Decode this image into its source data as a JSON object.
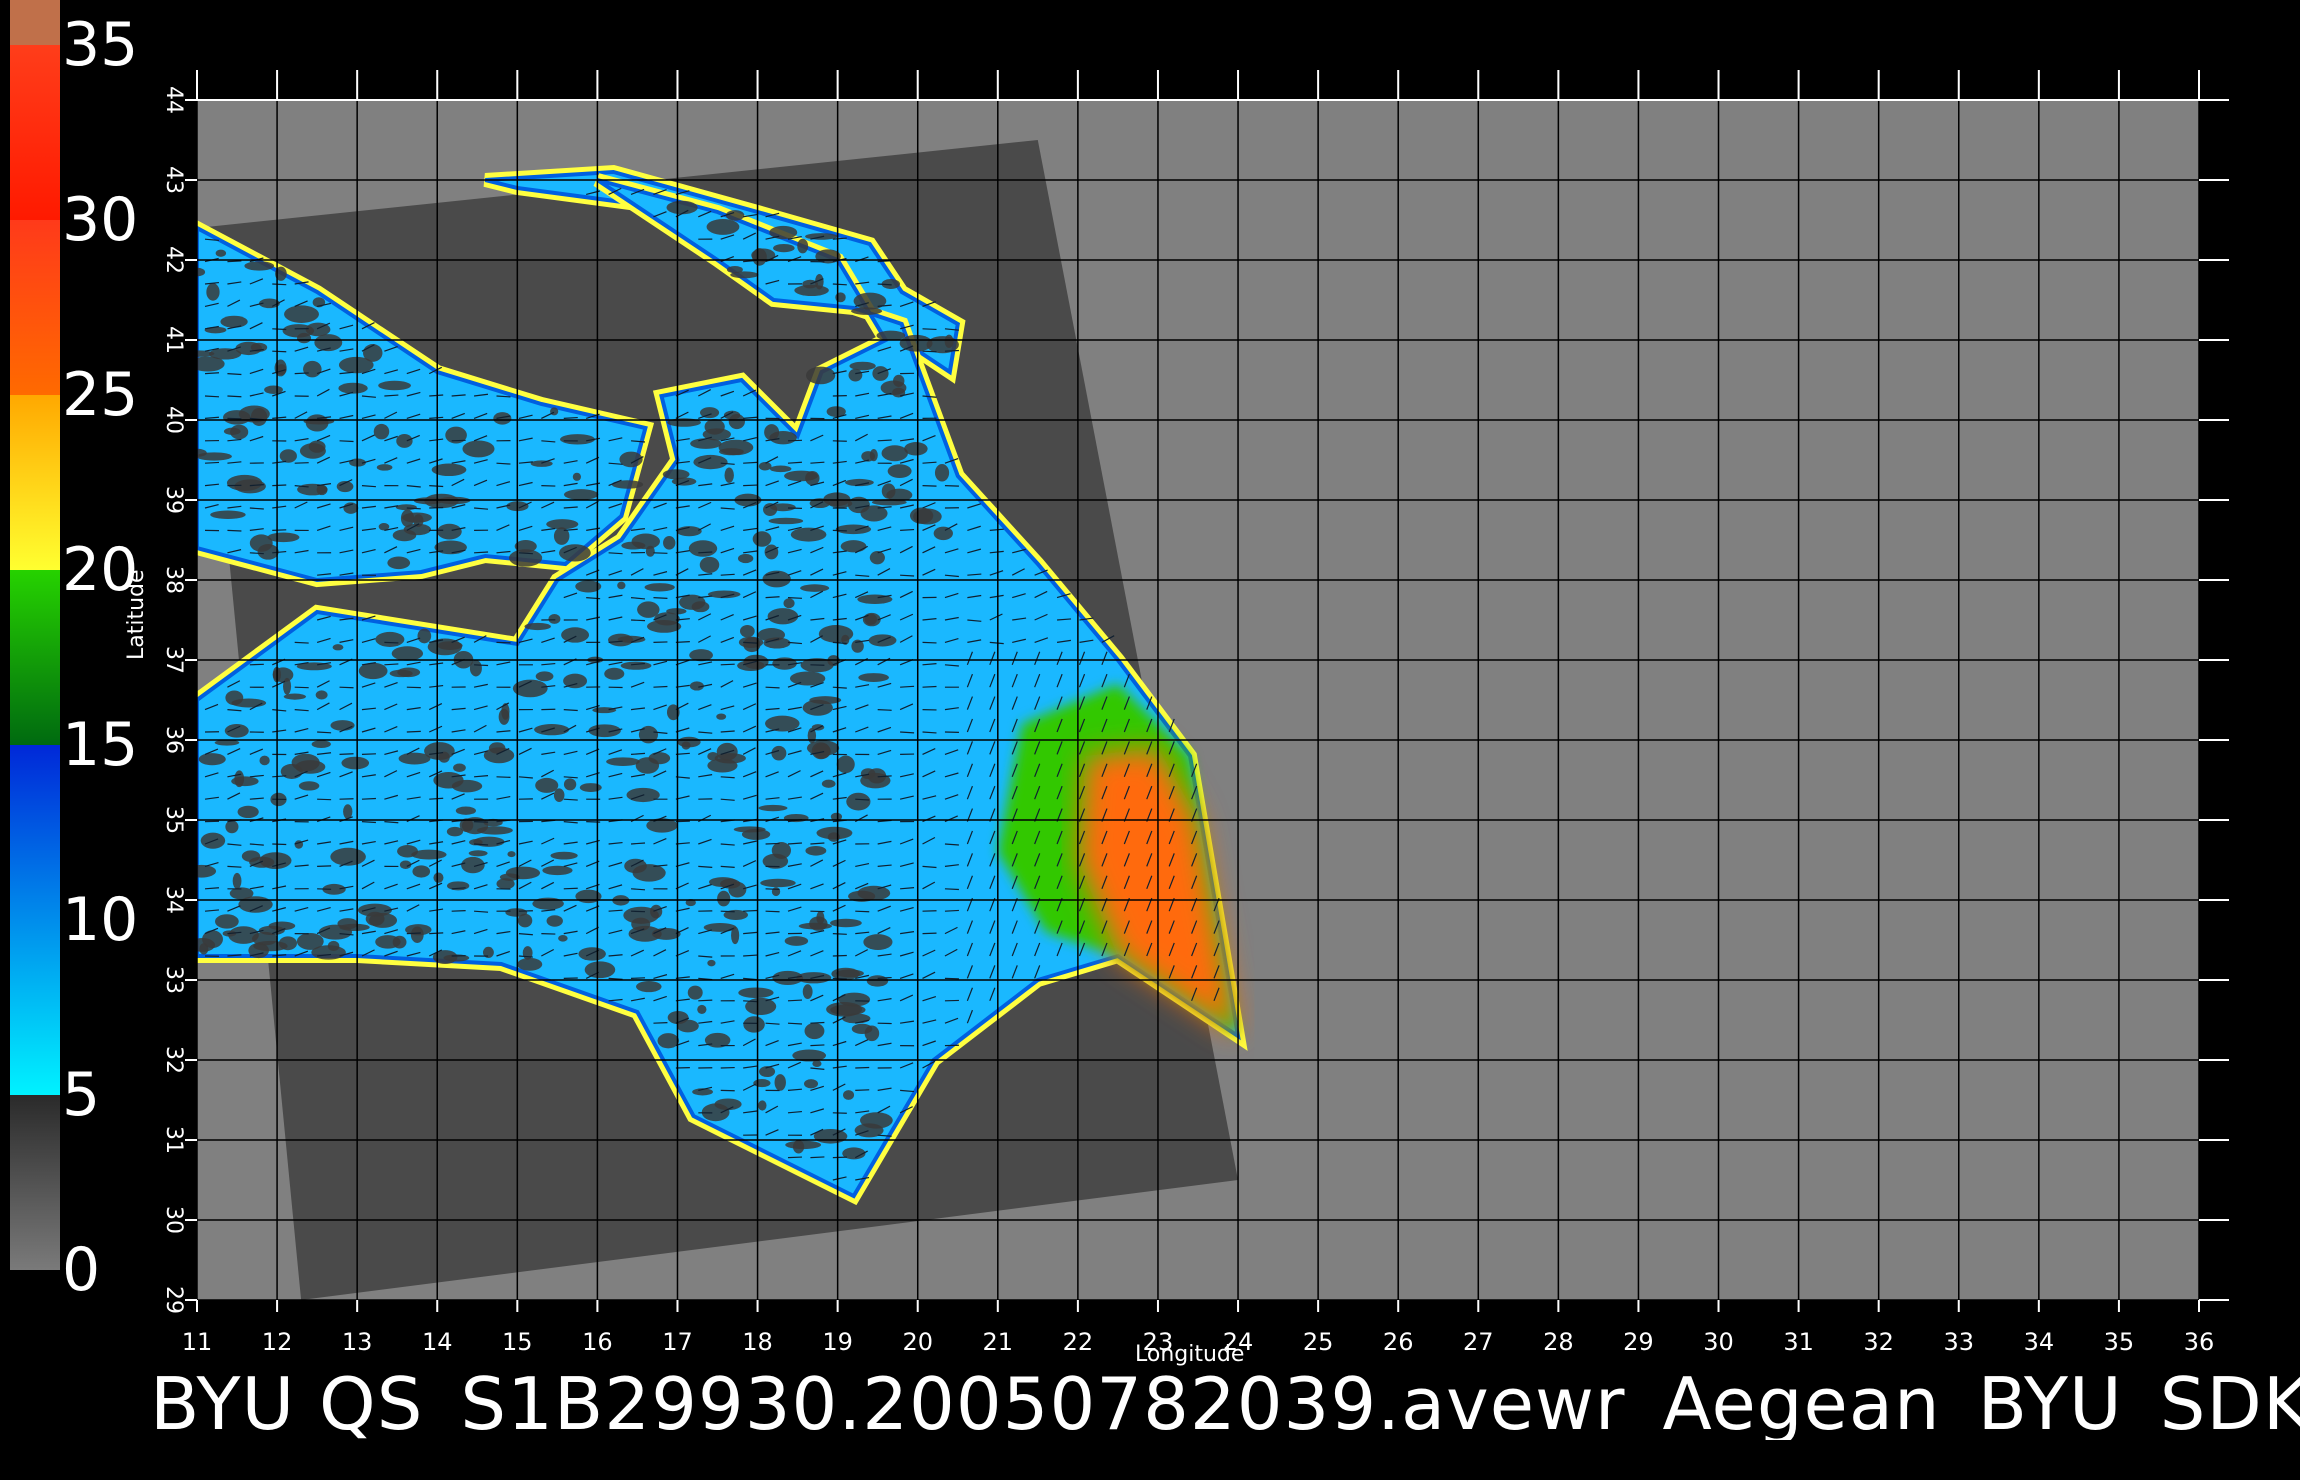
{
  "title": "BYU  QS_S1B29930.20050782039.avewr_Aegean_BYU_SDK",
  "colorbar": {
    "ticks": [
      "35",
      "30",
      "25",
      "20",
      "15",
      "10",
      "5",
      "0"
    ],
    "bands": [
      {
        "from": 0,
        "to": 5,
        "colors": [
          "#7a7a7a",
          "#2a2a2a"
        ]
      },
      {
        "from": 5,
        "to": 15,
        "colors": [
          "#00f2ff",
          "#0028d8"
        ]
      },
      {
        "from": 15,
        "to": 20,
        "colors": [
          "#006a10",
          "#26d200"
        ]
      },
      {
        "from": 20,
        "to": 25,
        "colors": [
          "#ffff30",
          "#ffa800"
        ]
      },
      {
        "from": 25,
        "to": 30,
        "colors": [
          "#ff6a00",
          "#ff3a1a"
        ]
      },
      {
        "from": 30,
        "to": 35,
        "colors": [
          "#ff1a00",
          "#ff3d1a"
        ]
      },
      {
        "from": 35,
        "to": 37,
        "colors": [
          "#c0704a",
          "#c0704a"
        ]
      }
    ]
  },
  "axes": {
    "xlabel": "Longitude",
    "ylabel": "Latitude",
    "x_ticks": [
      "11",
      "12",
      "13",
      "14",
      "15",
      "16",
      "17",
      "18",
      "19",
      "20",
      "21",
      "22",
      "23",
      "24",
      "25",
      "26",
      "27",
      "28",
      "29",
      "30",
      "31",
      "32",
      "33",
      "34",
      "35",
      "36"
    ],
    "y_ticks": [
      "29",
      "30",
      "31",
      "32",
      "33",
      "34",
      "35",
      "36",
      "37",
      "38",
      "39",
      "40",
      "41",
      "42",
      "43",
      "44"
    ],
    "x_range": [
      11,
      36
    ],
    "y_range": [
      29,
      44
    ]
  },
  "colors": {
    "background": "#000000",
    "map_bg": "#808080",
    "swath": "#4a4a4a",
    "grid": "#000000"
  },
  "features": {
    "swath_corners_lonlat": [
      [
        11,
        42.4
      ],
      [
        21.5,
        43.5
      ],
      [
        24,
        30.5
      ],
      [
        12.3,
        29
      ]
    ],
    "sea_main_lonlat": [
      [
        11,
        36.5
      ],
      [
        12.5,
        37.6
      ],
      [
        15,
        37.2
      ],
      [
        15.5,
        38
      ],
      [
        16.3,
        38.5
      ],
      [
        17,
        39.5
      ],
      [
        16.8,
        40.3
      ],
      [
        17.8,
        40.5
      ],
      [
        18.5,
        39.8
      ],
      [
        18.8,
        40.6
      ],
      [
        19.6,
        41
      ],
      [
        19,
        42
      ],
      [
        17.5,
        42.6
      ],
      [
        16,
        43
      ],
      [
        17.5,
        42
      ],
      [
        18.2,
        41.5
      ],
      [
        19.2,
        41.4
      ],
      [
        19.8,
        41.2
      ],
      [
        20.5,
        39.3
      ],
      [
        21.5,
        38.2
      ],
      [
        22.5,
        37
      ],
      [
        23.4,
        35.8
      ],
      [
        24,
        32.3
      ],
      [
        22.5,
        33.3
      ],
      [
        21.5,
        33
      ],
      [
        20.2,
        32
      ],
      [
        19.2,
        30.3
      ],
      [
        17.2,
        31.3
      ],
      [
        16.5,
        32.6
      ],
      [
        14.8,
        33.2
      ],
      [
        13,
        33.3
      ],
      [
        11,
        33.3
      ]
    ],
    "sea_north_lonlat": [
      [
        11,
        42.4
      ],
      [
        12.5,
        41.6
      ],
      [
        14,
        40.6
      ],
      [
        15.3,
        40.2
      ],
      [
        16.6,
        39.9
      ],
      [
        16.3,
        38.8
      ],
      [
        15.6,
        38.2
      ],
      [
        14.6,
        38.3
      ],
      [
        13.8,
        38.1
      ],
      [
        12.5,
        38
      ],
      [
        11,
        38.4
      ]
    ],
    "adriatic_lonlat": [
      [
        14.6,
        43
      ],
      [
        16.2,
        43.1
      ],
      [
        18,
        42.6
      ],
      [
        19.4,
        42.2
      ],
      [
        19.8,
        41.6
      ],
      [
        20.5,
        41.2
      ],
      [
        20.4,
        40.6
      ],
      [
        19.8,
        41
      ],
      [
        19.3,
        41.5
      ],
      [
        18.7,
        42
      ],
      [
        17.8,
        42.4
      ],
      [
        16.5,
        42.7
      ],
      [
        15,
        42.9
      ]
    ],
    "warm_region_lonlat": [
      [
        21.3,
        36.2
      ],
      [
        22.5,
        36.7
      ],
      [
        23.4,
        35.8
      ],
      [
        24,
        32.3
      ],
      [
        22.5,
        33.3
      ],
      [
        21.6,
        33.6
      ],
      [
        21,
        34.6
      ]
    ],
    "orange_core_lonlat": [
      [
        22.1,
        35.8
      ],
      [
        23,
        35.9
      ],
      [
        23.5,
        35
      ],
      [
        24,
        32.3
      ],
      [
        22.5,
        33.3
      ],
      [
        22,
        34.5
      ]
    ]
  }
}
